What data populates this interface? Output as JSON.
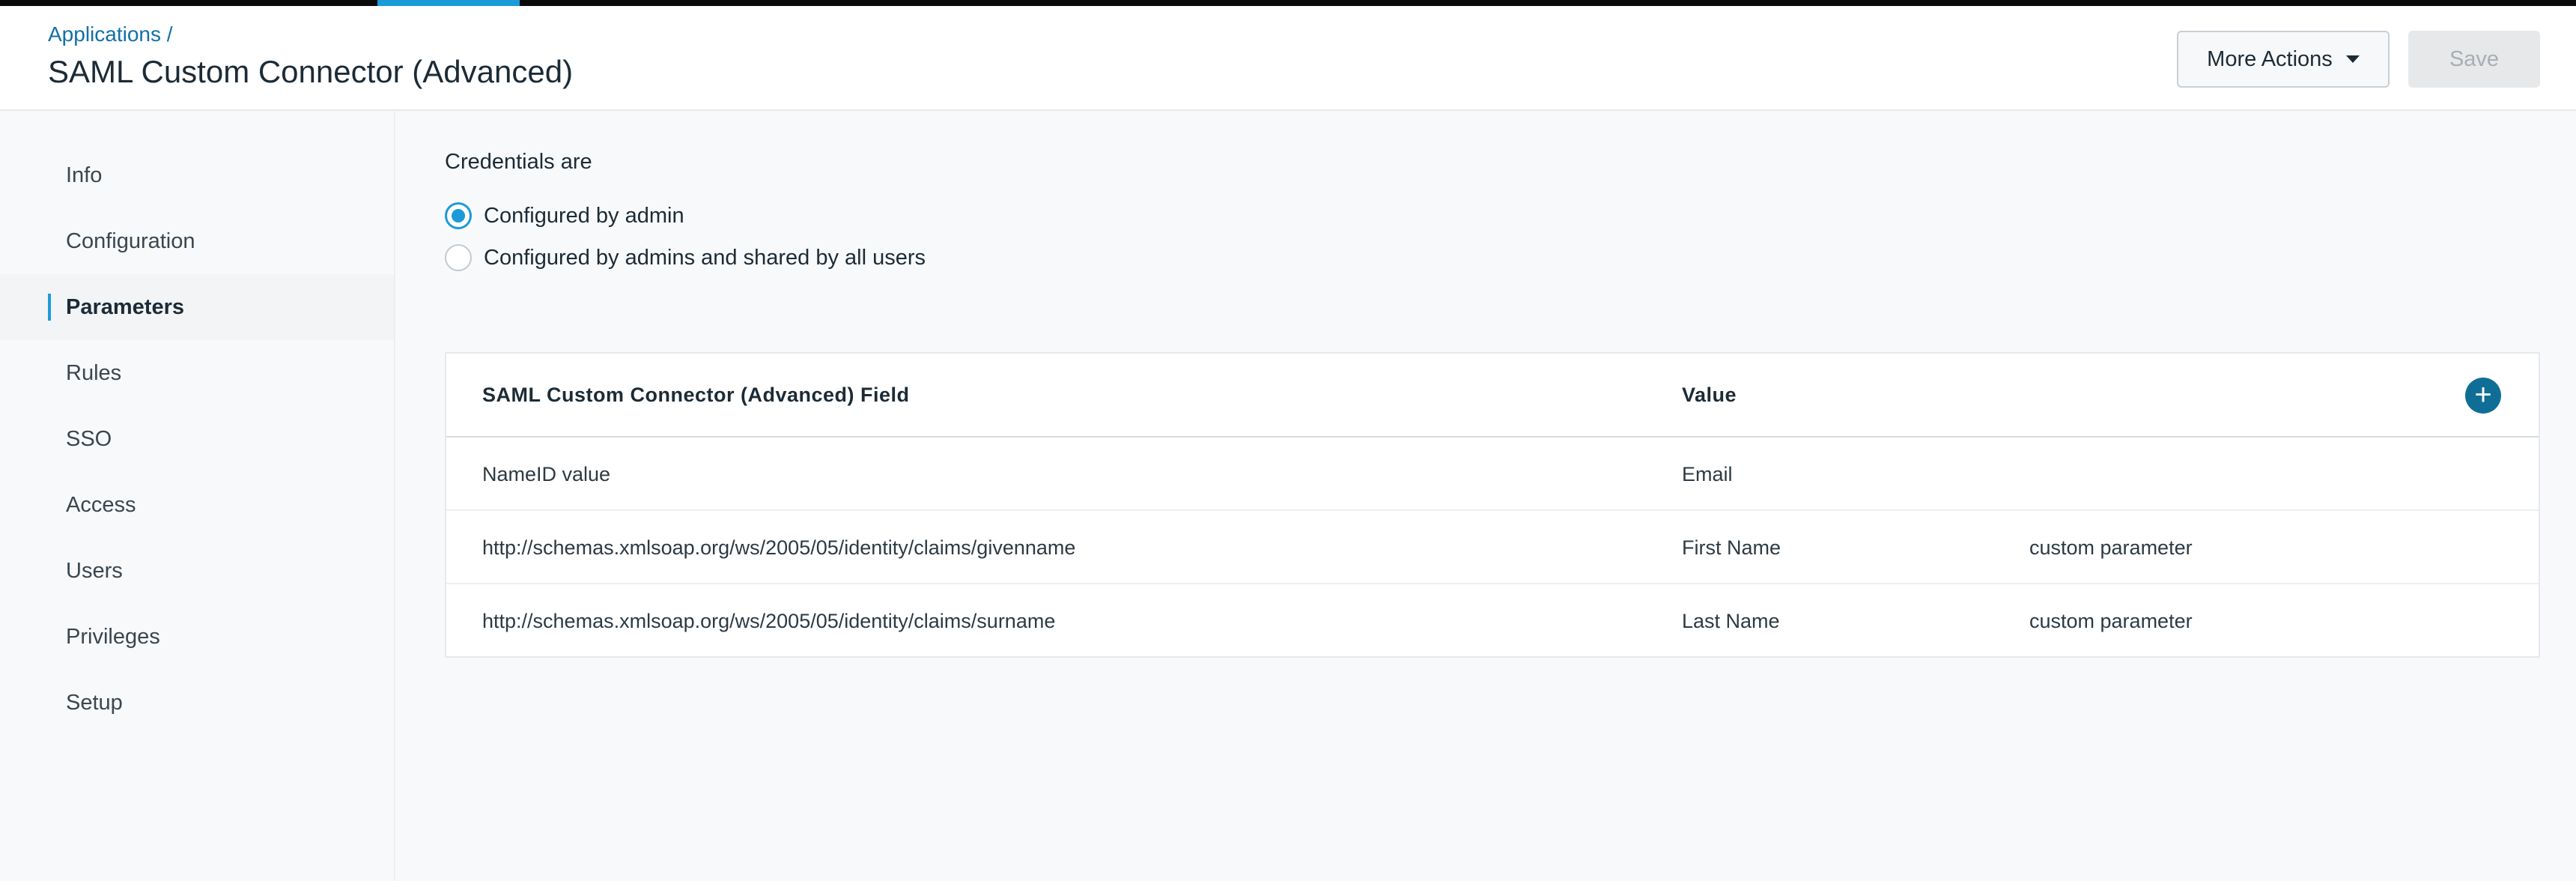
{
  "header": {
    "breadcrumb": "Applications /",
    "title": "SAML Custom Connector (Advanced)",
    "more_actions_label": "More Actions",
    "save_label": "Save"
  },
  "sidebar": {
    "items": [
      {
        "label": "Info",
        "active": false
      },
      {
        "label": "Configuration",
        "active": false
      },
      {
        "label": "Parameters",
        "active": true
      },
      {
        "label": "Rules",
        "active": false
      },
      {
        "label": "SSO",
        "active": false
      },
      {
        "label": "Access",
        "active": false
      },
      {
        "label": "Users",
        "active": false
      },
      {
        "label": "Privileges",
        "active": false
      },
      {
        "label": "Setup",
        "active": false
      }
    ]
  },
  "credentials": {
    "label": "Credentials are",
    "options": [
      {
        "label": "Configured by admin",
        "checked": true
      },
      {
        "label": "Configured by admins and shared by all users",
        "checked": false
      }
    ]
  },
  "table": {
    "headers": {
      "field": "SAML Custom Connector (Advanced) Field",
      "value": "Value"
    },
    "add_icon": "plus-icon",
    "rows": [
      {
        "field": "NameID value",
        "value": "Email",
        "note": ""
      },
      {
        "field": "http://schemas.xmlsoap.org/ws/2005/05/identity/claims/givenname",
        "value": "First Name",
        "note": "custom parameter"
      },
      {
        "field": "http://schemas.xmlsoap.org/ws/2005/05/identity/claims/surname",
        "value": "Last Name",
        "note": "custom parameter"
      }
    ]
  },
  "colors": {
    "accent": "#1a9bd7",
    "link": "#1270a8",
    "add_button": "#0f6e96"
  }
}
